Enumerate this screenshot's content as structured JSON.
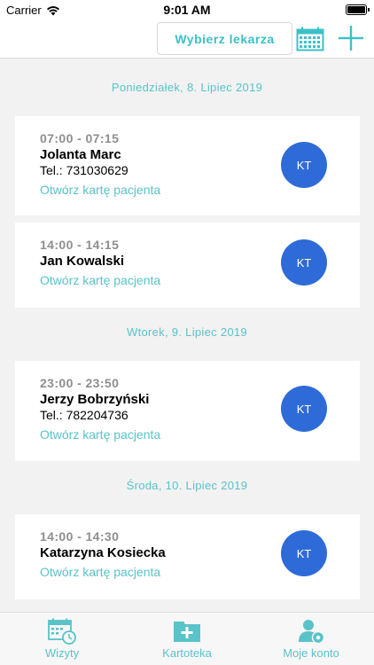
{
  "status_bar": {
    "carrier": "Carrier",
    "time": "9:01 AM"
  },
  "top_bar": {
    "doctor_button_label": "Wybierz lekarza",
    "accent_color": "#3cc0c8"
  },
  "days": [
    {
      "header": "Poniedziałek, 8. Lipiec 2019",
      "visits": [
        {
          "time": "07:00 - 07:15",
          "name": "Jolanta Marc",
          "phone": "Tel.: 731030629",
          "link": "Otwórz kartę pacjenta",
          "avatar": "KT"
        },
        {
          "time": "14:00 - 14:15",
          "name": "Jan Kowalski",
          "link": "Otwórz kartę pacjenta",
          "avatar": "KT"
        }
      ]
    },
    {
      "header": "Wtorek, 9. Lipiec 2019",
      "visits": [
        {
          "time": "23:00 - 23:50",
          "name": "Jerzy Bobrzyński",
          "phone": "Tel.: 782204736",
          "link": "Otwórz kartę pacjenta",
          "avatar": "KT"
        }
      ]
    },
    {
      "header": "Środa, 10. Lipiec 2019",
      "visits": [
        {
          "time": "14:00 - 14:30",
          "name": "Katarzyna Kosiecka",
          "link": "Otwórz kartę pacjenta",
          "avatar": "KT"
        }
      ]
    }
  ],
  "tab_bar": {
    "tabs": [
      {
        "label": "Wizyty",
        "icon": "calendar-clock-icon"
      },
      {
        "label": "Kartoteka",
        "icon": "folder-plus-icon"
      },
      {
        "label": "Moje konto",
        "icon": "user-gear-icon"
      }
    ]
  },
  "colors": {
    "accent": "#59c3c8",
    "avatar": "#2f6bd8"
  }
}
